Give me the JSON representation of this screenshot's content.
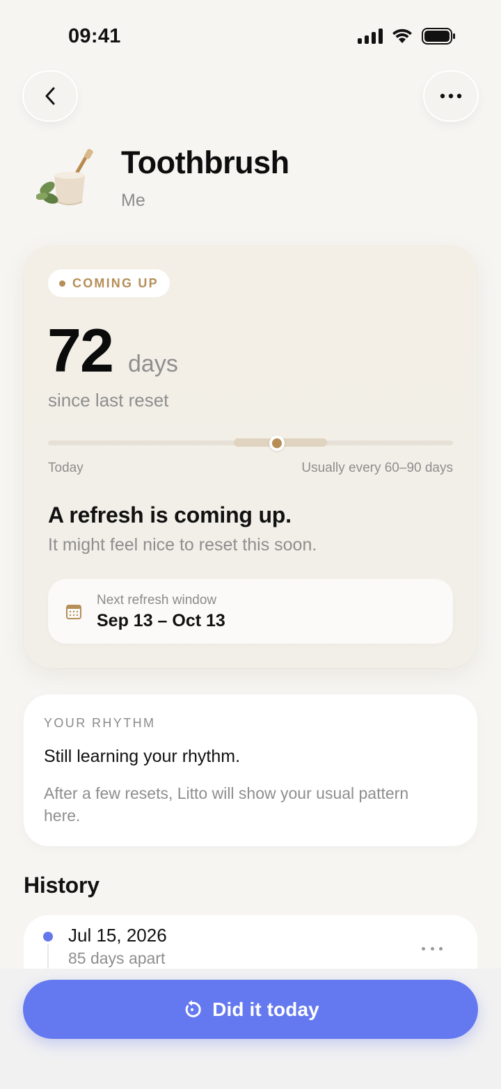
{
  "status_bar": {
    "time": "09:41"
  },
  "item": {
    "title": "Toothbrush",
    "owner": "Me",
    "icon": "toothbrush-cup-icon"
  },
  "status_card": {
    "badge": "COMING UP",
    "days_count": "72",
    "days_unit": "days",
    "since_label": "since last reset",
    "progress": {
      "left_label": "Today",
      "right_label": "Usually every 60–90 days",
      "current_days": 72,
      "range_days": [
        60,
        90
      ]
    },
    "headline": "A refresh is coming up.",
    "subline": "It might feel nice to reset this soon.",
    "window": {
      "label": "Next refresh window",
      "value": "Sep 13 – Oct 13"
    }
  },
  "rhythm": {
    "label": "YOUR RHYTHM",
    "title": "Still learning your rhythm.",
    "body": "After a few resets, Litto will show your usual pattern here."
  },
  "history": {
    "title": "History",
    "entries": [
      {
        "date": "Jul 15, 2026",
        "gap": "85 days apart"
      }
    ]
  },
  "cta": {
    "label": "Did it today"
  },
  "colors": {
    "accent": "#6479ef",
    "warm": "#b58e58",
    "background": "#f6f5f2"
  }
}
